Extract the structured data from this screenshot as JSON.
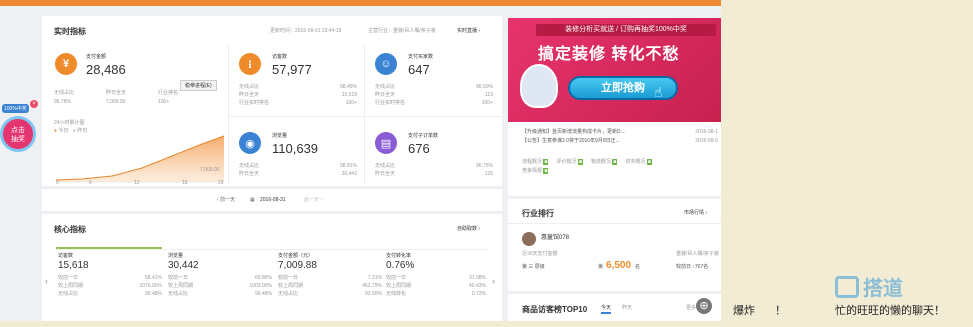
{
  "realtime": {
    "title": "实时指标",
    "updated": "更新时间：2016-09-01 23:44:15",
    "industry": "主营行业：重装/吊人偶/亲子装",
    "live_link": "实时直播 ›",
    "pay_amount": {
      "label": "支付金额",
      "value": "28,486",
      "wireless_label": "无线占比",
      "wireless": "96.78%",
      "yesterday_label": "昨日全天",
      "yesterday": "7,009.00",
      "rank_label": "行业排名",
      "rank": "100+"
    },
    "visitors": {
      "label": "访客数",
      "value": "57,977",
      "wireless_label": "无线占比",
      "wireless": "98.45%",
      "yesterday_label": "昨日全天",
      "yesterday": "15,618",
      "rank_label": "行业实时排名",
      "rank": "100+"
    },
    "buyers": {
      "label": "支付买家数",
      "value": "647",
      "wireless_label": "无线占比",
      "wireless": "96.60%",
      "yesterday_label": "昨日全天",
      "yesterday": "119",
      "rank_label": "行业实时排名",
      "rank": "100+"
    },
    "pageviews": {
      "label": "浏览量",
      "value": "110,639",
      "wireless_label": "无线占比",
      "wireless": "98.81%",
      "yesterday_label": "昨日全天",
      "yesterday": "30,442"
    },
    "orders": {
      "label": "支付子订单数",
      "value": "676",
      "wireless_label": "无线占比",
      "wireless": "96.75%",
      "yesterday_label": "昨日全天",
      "yesterday": "125"
    },
    "chart_legend_title": "24小时累计图",
    "chart_legend_today": "今日",
    "chart_legend_yesterday": "昨日",
    "chart_ticks": [
      "0",
      "6",
      "12",
      "18",
      "23"
    ],
    "chart_value": "7,009.00",
    "tooltip": "稳帝进程(E)",
    "date_prev": "‹ 前一天",
    "date": "2016-08-31",
    "date_next": "后一天 ›"
  },
  "core": {
    "title": "核心指标",
    "more": "自助取数 ›",
    "cols": [
      {
        "label": "访客数",
        "value": "15,618",
        "r1l": "较前一日",
        "r1": "58.41%",
        "r2l": "较上周同期",
        "r2": "1076.00%",
        "r3l": "无线占比",
        "r3": "99.48%"
      },
      {
        "label": "浏览量",
        "value": "30,442",
        "r1l": "较前一日",
        "r1": "60.86%",
        "r2l": "较上周同期",
        "r2": "1003.00%",
        "r3l": "无线占比",
        "r3": "99.48%"
      },
      {
        "label": "支付金额（元）",
        "value": "7,009.88",
        "r1l": "较前一日",
        "r1": "7.31%",
        "r2l": "较上周同期",
        "r2": "452.79%",
        "r3l": "无线占比",
        "r3": "93.60%"
      },
      {
        "label": "支付转化率",
        "value": "0.76%",
        "r1l": "较前一日",
        "r1": "31.08%",
        "r2l": "较上周同期",
        "r2": "40.43%",
        "r3l": "无线转化",
        "r3": "0.72%"
      }
    ]
  },
  "banner": {
    "top": "装修分析买就送 / 订购再抽奖100%中奖",
    "headline": "搞定装修  转化不愁",
    "button": "立即抢购"
  },
  "notices": [
    {
      "text": "【升级通知】首页新增流量构成卡片，更新D...",
      "date": "2016-08-1"
    },
    {
      "text": "【公告】生意参谋2.0将于2016年9月8日正...",
      "date": "2016-09-0"
    }
  ],
  "tags": [
    "流程概况",
    "评价概况",
    "物流概况",
    "财务概况",
    "竞争情报"
  ],
  "ranking": {
    "title": "行业排行",
    "more": "市场行情 ›",
    "user": "惠童馆078",
    "subtitle": "近30天支付金额",
    "rank_label": "第 三 层级",
    "amount_prefix": "第",
    "amount": "6,500",
    "amount_suffix": "名",
    "cat": "重装/吊人偶/亲子装",
    "cmp": "较前日 ↑707名"
  },
  "top10": {
    "title": "商品访客榜TOP10",
    "tab1": "今天",
    "tab2": "昨天",
    "more": "更多 ›"
  },
  "floating": {
    "badge": "100%中奖",
    "line1": "点击",
    "line2": "抽奖"
  },
  "outside": {
    "text1": "爆炸",
    "text2": "！",
    "text3": "忙的旺旺的懒的聊天！"
  },
  "watermark": "搭道",
  "colors": {
    "orange": "#f08b2b",
    "blue": "#3a82d4",
    "purple": "#8a5cd6",
    "accent": "#ec8a33"
  }
}
